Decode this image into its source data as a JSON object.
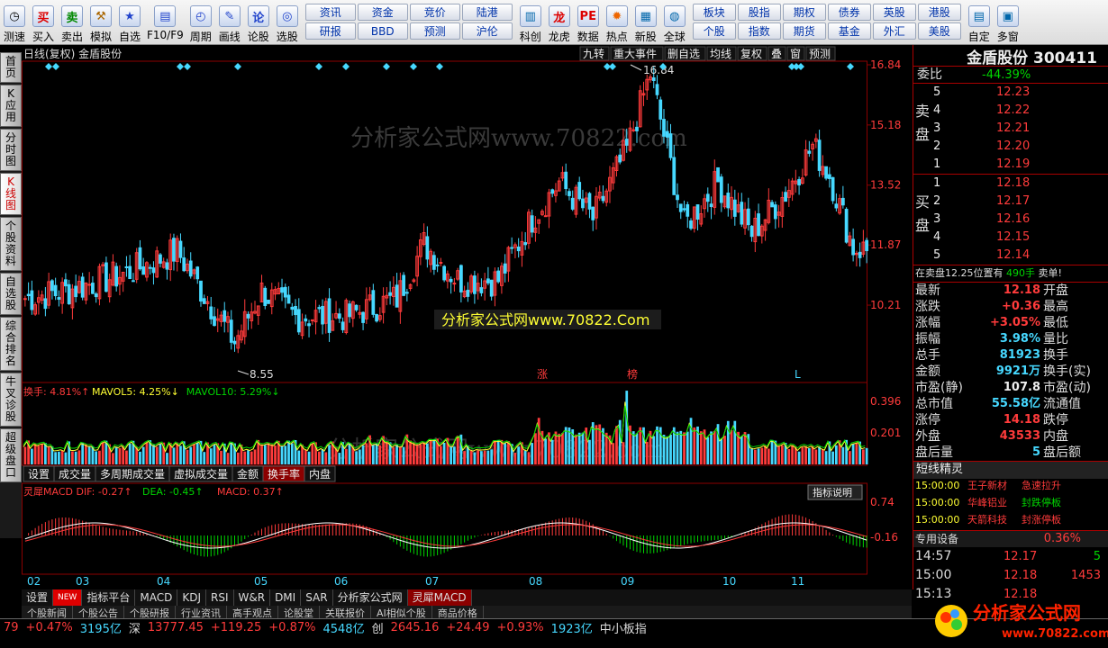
{
  "toolbar": {
    "items": [
      {
        "icon": "clock-icon",
        "glyph": "◷",
        "label": "测速"
      },
      {
        "icon": "buy-icon",
        "glyph": "买",
        "label": "买入",
        "color": "#d00"
      },
      {
        "icon": "sell-icon",
        "glyph": "卖",
        "label": "卖出",
        "color": "#080"
      },
      {
        "icon": "hammer-icon",
        "glyph": "⚒",
        "label": "模拟",
        "color": "#a60"
      },
      {
        "icon": "star-icon",
        "glyph": "★",
        "label": "自选",
        "color": "#24c"
      },
      {
        "icon": "f10-icon",
        "glyph": "▤",
        "label": "F10/F9",
        "color": "#24c"
      },
      {
        "icon": "period-icon",
        "glyph": "◴",
        "label": "周期",
        "color": "#24c"
      },
      {
        "icon": "pen-icon",
        "glyph": "✎",
        "label": "画线",
        "color": "#24c"
      },
      {
        "icon": "lungu-icon",
        "glyph": "论",
        "label": "论股",
        "color": "#24c"
      },
      {
        "icon": "select-icon",
        "glyph": "◎",
        "label": "选股",
        "color": "#24c"
      }
    ],
    "grid1": [
      "资讯",
      "资金",
      "竞价",
      "陆港",
      "研报",
      "BBD",
      "预测",
      "沪伦"
    ],
    "items2": [
      {
        "icon": "kechuang-icon",
        "glyph": "▥",
        "label": "科创",
        "color": "#06a"
      },
      {
        "icon": "dragon-icon",
        "glyph": "龙",
        "label": "龙虎",
        "color": "#d00"
      },
      {
        "icon": "data-icon",
        "glyph": "PE",
        "label": "数据",
        "color": "#d00"
      },
      {
        "icon": "hot-icon",
        "glyph": "✹",
        "label": "热点",
        "color": "#e60"
      },
      {
        "icon": "newstock-icon",
        "glyph": "▦",
        "label": "新股",
        "color": "#06a"
      },
      {
        "icon": "globe-icon",
        "glyph": "◍",
        "label": "全球",
        "color": "#06a"
      }
    ],
    "grid2": [
      "板块",
      "股指",
      "期权",
      "债券",
      "英股",
      "港股",
      "个股",
      "指数",
      "期货",
      "基金",
      "外汇",
      "美股"
    ],
    "items3": [
      {
        "icon": "custom-icon",
        "glyph": "▤",
        "label": "自定",
        "color": "#06a"
      },
      {
        "icon": "multiwin-icon",
        "glyph": "▣",
        "label": "多窗",
        "color": "#06a"
      }
    ]
  },
  "leftnav": [
    "首页",
    "K应用",
    "分时图",
    "K线图",
    "个股资料",
    "自选股",
    "综合排名",
    "牛叉诊股",
    "超级盘口"
  ],
  "chart": {
    "header_left": "日线(复权)  金盾股份",
    "header_buttons": [
      "九转",
      "重大事件",
      "删自选",
      "均线",
      "复权",
      "叠",
      "窗",
      "预测"
    ],
    "watermark": "分析家公式网www.70822.com",
    "watermark_box": "分析家公式网www.70822.Com",
    "high_label": "16.84",
    "low_label": "8.55",
    "price_ticks": [
      "16.84",
      "15.18",
      "13.52",
      "11.87",
      "10.21"
    ],
    "markers": [
      "涨",
      "榜",
      "L"
    ],
    "vol_header": [
      {
        "text": "换手: 4.81%↑",
        "color": "#ff3b3b"
      },
      {
        "text": "MAVOL5: 4.25%↓",
        "color": "#ffff33"
      },
      {
        "text": "MAVOL10: 5.29%↓",
        "color": "#00d600"
      }
    ],
    "vol_ticks": [
      "0.396",
      "0.201"
    ],
    "vol_tabs": [
      "设置",
      "成交量",
      "多周期成交量",
      "虚拟成交量",
      "金额",
      "换手率",
      "内盘"
    ],
    "vol_tab_active": "换手率",
    "macd_header": [
      {
        "text": "灵犀MACD DIF: -0.27↑",
        "color": "#ff3b3b"
      },
      {
        "text": "DEA: -0.45↑",
        "color": "#00d600"
      },
      {
        "text": "MACD: 0.37↑",
        "color": "#ff3b3b"
      }
    ],
    "macd_button": "指标说明",
    "macd_ticks": [
      "0.74",
      "-0.16"
    ],
    "months": [
      "02",
      "03",
      "04",
      "05",
      "06",
      "07",
      "08",
      "09",
      "10",
      "11"
    ]
  },
  "bottomtabs": [
    "设置",
    "NEW",
    "指标平台",
    "MACD",
    "KDJ",
    "RSI",
    "W&R",
    "DMI",
    "SAR",
    "分析家公式网",
    "灵犀MACD"
  ],
  "subtabs": [
    "个股新闻",
    "个股公告",
    "个股研报",
    "行业资讯",
    "高手观点",
    "论股堂",
    "关联报价",
    "AI相似个股",
    "商品价格"
  ],
  "panel": {
    "stock_name": "金盾股份",
    "stock_code": "300411",
    "weibi_label": "委比",
    "weibi": "-44.39%",
    "sell_label": "卖盘",
    "buy_label": "买盘",
    "asks": [
      {
        "n": "5",
        "p": "12.23"
      },
      {
        "n": "4",
        "p": "12.22"
      },
      {
        "n": "3",
        "p": "12.21"
      },
      {
        "n": "2",
        "p": "12.20"
      },
      {
        "n": "1",
        "p": "12.19"
      }
    ],
    "bids": [
      {
        "n": "1",
        "p": "12.18"
      },
      {
        "n": "2",
        "p": "12.17"
      },
      {
        "n": "3",
        "p": "12.16"
      },
      {
        "n": "4",
        "p": "12.15"
      },
      {
        "n": "5",
        "p": "12.14"
      }
    ],
    "notice": "在卖盘12.25位置有",
    "notice_vol": "490手",
    "notice_tail": "卖单!",
    "stats": [
      [
        "最新",
        "12.18",
        "red",
        "开盘",
        ""
      ],
      [
        "涨跌",
        "+0.36",
        "red",
        "最高",
        ""
      ],
      [
        "涨幅",
        "+3.05%",
        "red",
        "最低",
        ""
      ],
      [
        "振幅",
        "3.98%",
        "cyn",
        "量比",
        ""
      ],
      [
        "总手",
        "81923",
        "cyn",
        "换手",
        ""
      ],
      [
        "金额",
        "9921万",
        "cyn",
        "换手(实)",
        ""
      ],
      [
        "市盈(静)",
        "107.8",
        "wht",
        "市盈(动)",
        ""
      ],
      [
        "总市值",
        "55.58亿",
        "cyn",
        "流通值",
        ""
      ],
      [
        "涨停",
        "14.18",
        "red",
        "跌停",
        ""
      ],
      [
        "外盘",
        "43533",
        "red",
        "内盘",
        ""
      ],
      [
        "盘后量",
        "5",
        "cyn",
        "盘后额",
        ""
      ]
    ],
    "sprite_title": "短线精灵",
    "sprite": [
      [
        "15:00:00",
        "王子新材",
        "急速拉升"
      ],
      [
        "15:00:00",
        "华峰铝业",
        "封跌停板"
      ],
      [
        "15:00:00",
        "天箭科技",
        "封涨停板"
      ]
    ],
    "equip_label": "专用设备",
    "equip_pct": "0.36%",
    "ticks": [
      [
        "14:57",
        "12.17",
        "5"
      ],
      [
        "15:00",
        "12.18",
        "1453"
      ],
      [
        "15:13",
        "12.18",
        ""
      ]
    ]
  },
  "status": [
    {
      "t": "79",
      "c": "#ff3b3b"
    },
    {
      "t": "+0.47%",
      "c": "#ff3b3b"
    },
    {
      "t": "3195亿",
      "c": "#46d8ff"
    },
    {
      "t": "深",
      "c": "#ddd"
    },
    {
      "t": "13777.45",
      "c": "#ff3b3b"
    },
    {
      "t": "+119.25",
      "c": "#ff3b3b"
    },
    {
      "t": "+0.87%",
      "c": "#ff3b3b"
    },
    {
      "t": "4548亿",
      "c": "#46d8ff"
    },
    {
      "t": "创",
      "c": "#ddd"
    },
    {
      "t": "2645.16",
      "c": "#ff3b3b"
    },
    {
      "t": "+24.49",
      "c": "#ff3b3b"
    },
    {
      "t": "+0.93%",
      "c": "#ff3b3b"
    },
    {
      "t": "1923亿",
      "c": "#46d8ff"
    },
    {
      "t": "中小板指",
      "c": "#ddd"
    }
  ],
  "brand": {
    "text": "分析家公式网",
    "url": "www.70822.com"
  },
  "colors": {
    "up": "#ff3b3b",
    "down": "#46d8ff",
    "grid": "#8b0000"
  }
}
